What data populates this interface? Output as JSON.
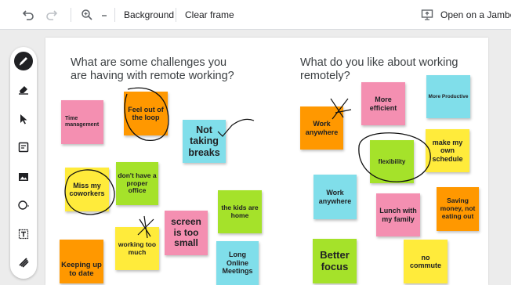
{
  "toolbar": {
    "background_label": "Background",
    "clear_frame_label": "Clear frame",
    "open_jamboard_label": "Open on a Jamboard"
  },
  "sidebar": {
    "tools": [
      "pen",
      "eraser",
      "select",
      "sticky-note",
      "image",
      "circle",
      "text-box",
      "laser"
    ]
  },
  "canvas": {
    "question_left_1": "What are some challenges you",
    "question_left_2": "are having with remote working?",
    "question_right_1": "What do you like about working",
    "question_right_2": "remotely?",
    "notes": [
      {
        "text": "Time management",
        "color": "#f48fb1"
      },
      {
        "text": "Feel out of the loop",
        "color": "#ff9800"
      },
      {
        "text": "Not taking breaks",
        "color": "#80deea"
      },
      {
        "text": "Miss my coworkers",
        "color": "#ffeb3b"
      },
      {
        "text": "don't have a proper office",
        "color": "#a5e22a"
      },
      {
        "text": "the kids are home",
        "color": "#a5e22a"
      },
      {
        "text": "screen is too small",
        "color": "#f48fb1"
      },
      {
        "text": "working too much",
        "color": "#ffeb3b"
      },
      {
        "text": "Keeping up to date",
        "color": "#ff9800"
      },
      {
        "text": "Long Online Meetings",
        "color": "#80deea"
      },
      {
        "text": "Work anywhere",
        "color": "#ff9800"
      },
      {
        "text": "More efficient",
        "color": "#f48fb1"
      },
      {
        "text": "More Productive",
        "color": "#80deea"
      },
      {
        "text": "flexibility",
        "color": "#a5e22a"
      },
      {
        "text": "make my own schedule",
        "color": "#ffeb3b"
      },
      {
        "text": "Work anywhere",
        "color": "#80deea"
      },
      {
        "text": "Lunch with my family",
        "color": "#f48fb1"
      },
      {
        "text": "Saving money, not eating out",
        "color": "#ff9800"
      },
      {
        "text": "Better focus",
        "color": "#a5e22a"
      },
      {
        "text": "no commute",
        "color": "#ffeb3b"
      }
    ]
  }
}
